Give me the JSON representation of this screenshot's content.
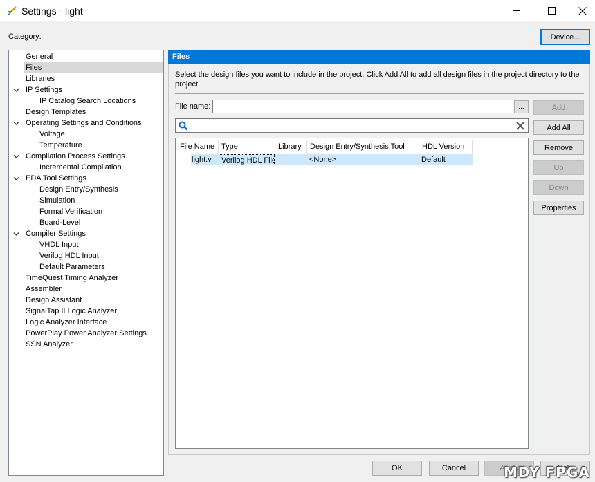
{
  "window": {
    "title": "Settings - light",
    "controls": [
      "minimize-icon",
      "maximize-icon",
      "close-icon"
    ]
  },
  "category_label": "Category:",
  "device_button": "Device...",
  "tree": {
    "items": [
      {
        "label": "General",
        "level": 1,
        "expander": false
      },
      {
        "label": "Files",
        "level": 1,
        "expander": false,
        "selected": true
      },
      {
        "label": "Libraries",
        "level": 1,
        "expander": false
      },
      {
        "label": "IP Settings",
        "level": 1,
        "expander": true
      },
      {
        "label": "IP Catalog Search Locations",
        "level": 2,
        "expander": false
      },
      {
        "label": "Design Templates",
        "level": 1,
        "expander": false
      },
      {
        "label": "Operating Settings and Conditions",
        "level": 1,
        "expander": true
      },
      {
        "label": "Voltage",
        "level": 2,
        "expander": false
      },
      {
        "label": "Temperature",
        "level": 2,
        "expander": false
      },
      {
        "label": "Compilation Process Settings",
        "level": 1,
        "expander": true
      },
      {
        "label": "Incremental Compilation",
        "level": 2,
        "expander": false
      },
      {
        "label": "EDA Tool Settings",
        "level": 1,
        "expander": true
      },
      {
        "label": "Design Entry/Synthesis",
        "level": 2,
        "expander": false
      },
      {
        "label": "Simulation",
        "level": 2,
        "expander": false
      },
      {
        "label": "Formal Verification",
        "level": 2,
        "expander": false
      },
      {
        "label": "Board-Level",
        "level": 2,
        "expander": false
      },
      {
        "label": "Compiler Settings",
        "level": 1,
        "expander": true
      },
      {
        "label": "VHDL Input",
        "level": 2,
        "expander": false
      },
      {
        "label": "Verilog HDL Input",
        "level": 2,
        "expander": false
      },
      {
        "label": "Default Parameters",
        "level": 2,
        "expander": false
      },
      {
        "label": "TimeQuest Timing Analyzer",
        "level": 1,
        "expander": false
      },
      {
        "label": "Assembler",
        "level": 1,
        "expander": false
      },
      {
        "label": "Design Assistant",
        "level": 1,
        "expander": false
      },
      {
        "label": "SignalTap II Logic Analyzer",
        "level": 1,
        "expander": false
      },
      {
        "label": "Logic Analyzer Interface",
        "level": 1,
        "expander": false
      },
      {
        "label": "PowerPlay Power Analyzer Settings",
        "level": 1,
        "expander": false
      },
      {
        "label": "SSN Analyzer",
        "level": 1,
        "expander": false
      }
    ]
  },
  "panel": {
    "title": "Files",
    "description": "Select the design files you want to include in the project. Click Add All to add all design files in the project directory to the project.",
    "file_name_label": "File name:",
    "file_name_value": "",
    "browse_label": "...",
    "search_value": ""
  },
  "table": {
    "columns": [
      "File Name",
      "Type",
      "Library",
      "Design Entry/Synthesis Tool",
      "HDL Version"
    ],
    "rows": [
      {
        "file_name": "light.v",
        "type": "Verilog HDL File",
        "library": "",
        "tool": "<None>",
        "hdl_version": "Default"
      }
    ]
  },
  "side_buttons": [
    {
      "label": "Add",
      "enabled": false
    },
    {
      "label": "Add All",
      "enabled": true
    },
    {
      "label": "Remove",
      "enabled": true
    },
    {
      "label": "Up",
      "enabled": false
    },
    {
      "label": "Down",
      "enabled": false
    },
    {
      "label": "Properties",
      "enabled": true
    }
  ],
  "bottom_buttons": [
    {
      "label": "OK",
      "enabled": true
    },
    {
      "label": "Cancel",
      "enabled": true
    },
    {
      "label": "Apply",
      "enabled": false
    },
    {
      "label": "Help",
      "enabled": true
    }
  ],
  "watermark": "MDY FPGA",
  "colors": {
    "accent": "#0078d7",
    "selection": "#cce8ff",
    "tree_selection": "#d9d9d9"
  }
}
